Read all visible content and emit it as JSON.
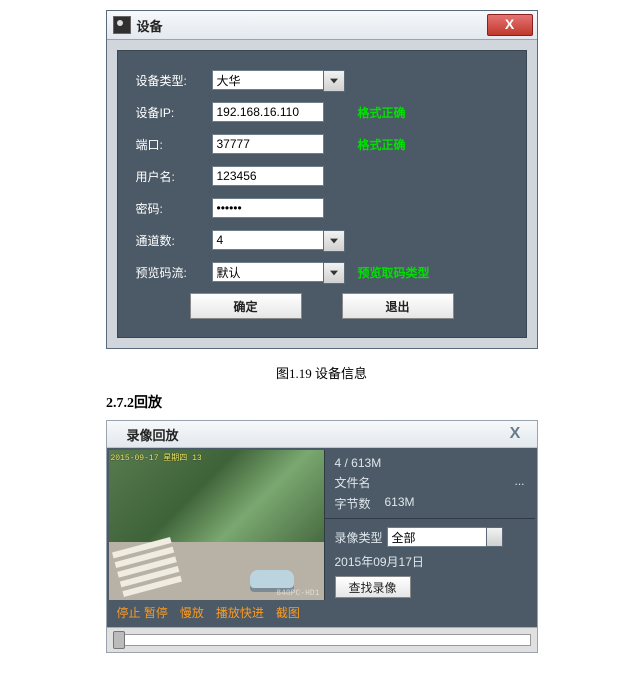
{
  "dialog1": {
    "title": "设备",
    "close_glyph": "X",
    "labels": {
      "device_type": "设备类型:",
      "device_ip": "设备IP:",
      "port": "端口:",
      "username": "用户名:",
      "password": "密码:",
      "channels": "通道数:",
      "preview_stream": "预览码流:"
    },
    "values": {
      "device_type": "大华",
      "device_ip": "192.168.16.110",
      "port": "37777",
      "username": "123456",
      "password": "••••••",
      "channels": "4",
      "preview_stream": "默认"
    },
    "validation": {
      "ip_ok": "格式正确",
      "port_ok": "格式正确",
      "stream_ok": "预览取码类型"
    },
    "buttons": {
      "ok": "确定",
      "exit": "退出"
    }
  },
  "caption1": "图1.19 设备信息",
  "section_heading": "2.7.2回放",
  "dialog2": {
    "title": "录像回放",
    "close_glyph": "X",
    "video_timestamp": "2015-09-17  星期四 13",
    "video_watermark": "840PC-HD1",
    "progress_line": "4 / 613M",
    "file_label": "文件名",
    "file_value": "...",
    "bytes_label": "字节数",
    "bytes_value": "613M",
    "record_type_label": "录像类型",
    "record_type_value": "全部",
    "date": "2015年09月17日",
    "search_btn": "查找录像",
    "controls": {
      "stop_pause": "停止 暂停",
      "slow": "慢放",
      "fast": "播放快进",
      "snap": "截图"
    }
  }
}
